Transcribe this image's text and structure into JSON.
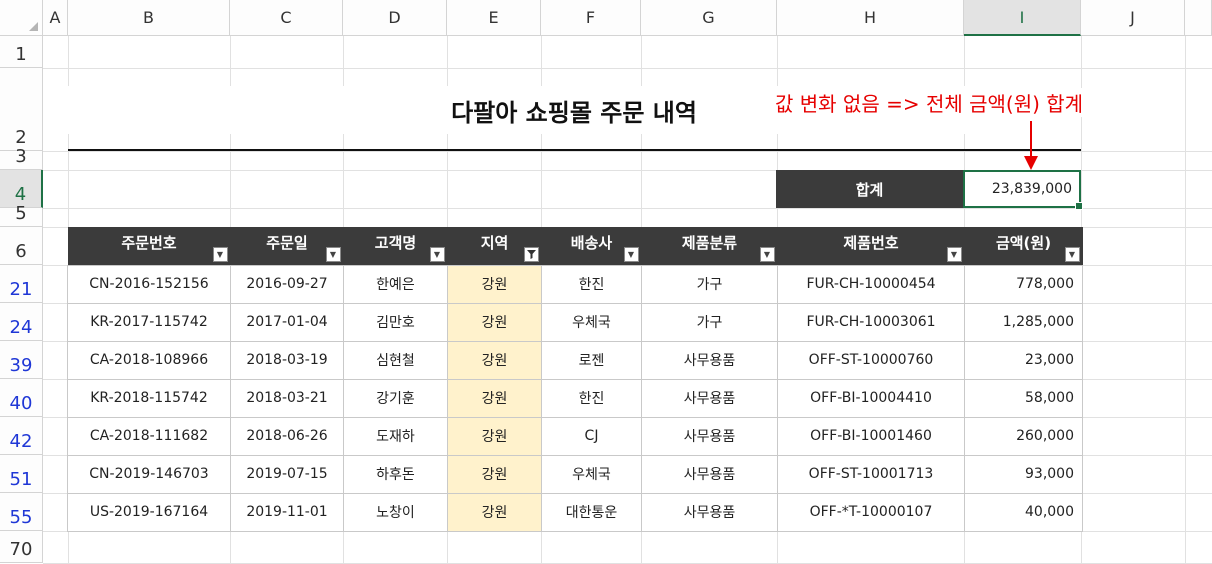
{
  "columns": [
    "A",
    "B",
    "C",
    "D",
    "E",
    "F",
    "G",
    "H",
    "I",
    "J"
  ],
  "selected_column": "I",
  "rows": [
    "1",
    "2",
    "3",
    "4",
    "5",
    "6",
    "21",
    "24",
    "39",
    "40",
    "42",
    "51",
    "55",
    "70"
  ],
  "selected_row": "4",
  "filtered_rows": [
    "21",
    "24",
    "39",
    "40",
    "42",
    "51",
    "55"
  ],
  "title": "다팔아 쇼핑몰 주문 내역",
  "annotation": "값 변화 없음 => 전체 금액(원) 합계",
  "summary": {
    "label": "합계",
    "value": "23,839,000"
  },
  "table": {
    "headers": [
      "주문번호",
      "주문일",
      "고객명",
      "지역",
      "배송사",
      "제품분류",
      "제품번호",
      "금액(원)"
    ],
    "filter_active_column": "지역",
    "rows": [
      [
        "CN-2016-152156",
        "2016-09-27",
        "한예은",
        "강원",
        "한진",
        "가구",
        "FUR-CH-10000454",
        "778,000"
      ],
      [
        "KR-2017-115742",
        "2017-01-04",
        "김만호",
        "강원",
        "우체국",
        "가구",
        "FUR-CH-10003061",
        "1,285,000"
      ],
      [
        "CA-2018-108966",
        "2018-03-19",
        "심현철",
        "강원",
        "로젠",
        "사무용품",
        "OFF-ST-10000760",
        "23,000"
      ],
      [
        "KR-2018-115742",
        "2018-03-21",
        "강기훈",
        "강원",
        "한진",
        "사무용품",
        "OFF-BI-10004410",
        "58,000"
      ],
      [
        "CA-2018-111682",
        "2018-06-26",
        "도재하",
        "강원",
        "CJ",
        "사무용품",
        "OFF-BI-10001460",
        "260,000"
      ],
      [
        "CN-2019-146703",
        "2019-07-15",
        "하후돈",
        "강원",
        "우체국",
        "사무용품",
        "OFF-ST-10001713",
        "93,000"
      ],
      [
        "US-2019-167164",
        "2019-11-01",
        "노창이",
        "강원",
        "대한통운",
        "사무용품",
        "OFF-*T-10000107",
        "40,000"
      ]
    ]
  },
  "colors": {
    "header_bg": "#3b3b3b",
    "region_fill": "#fff2cc",
    "annotation": "#e60000",
    "selection": "#1e7145",
    "filtered_row_number": "#1f37d6"
  },
  "icons": {
    "filter": "dropdown-arrow-icon",
    "filter_active": "filter-funnel-icon"
  }
}
